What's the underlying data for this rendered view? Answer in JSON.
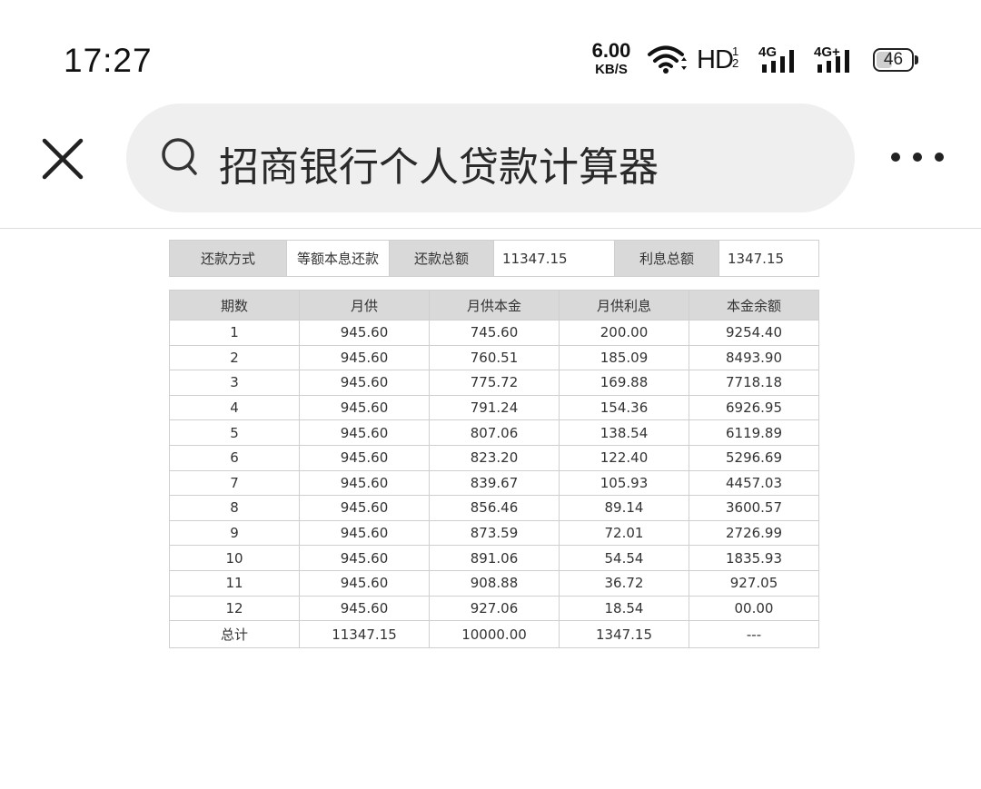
{
  "status_bar": {
    "time": "17:27",
    "net_speed_value": "6.00",
    "net_speed_unit": "KB/S",
    "hd_label": "HD",
    "hd_sub_top": "1",
    "hd_sub_bottom": "2",
    "signal1_label": "4G",
    "signal2_label": "4G+",
    "battery_percent": "46",
    "battery_level": 0.46
  },
  "top_bar": {
    "search_query": "招商银行个人贷款计算器",
    "icons": [
      "close-icon",
      "search-icon",
      "more-icon"
    ]
  },
  "summary": {
    "repay_method_label": "还款方式",
    "repay_method_value": "等额本息还款",
    "total_repay_label": "还款总额",
    "total_repay_value": "11347.15",
    "total_interest_label": "利息总额",
    "total_interest_value": "1347.15"
  },
  "schedule": {
    "headers": [
      "期数",
      "月供",
      "月供本金",
      "月供利息",
      "本金余额"
    ],
    "rows": [
      [
        "1",
        "945.60",
        "745.60",
        "200.00",
        "9254.40"
      ],
      [
        "2",
        "945.60",
        "760.51",
        "185.09",
        "8493.90"
      ],
      [
        "3",
        "945.60",
        "775.72",
        "169.88",
        "7718.18"
      ],
      [
        "4",
        "945.60",
        "791.24",
        "154.36",
        "6926.95"
      ],
      [
        "5",
        "945.60",
        "807.06",
        "138.54",
        "6119.89"
      ],
      [
        "6",
        "945.60",
        "823.20",
        "122.40",
        "5296.69"
      ],
      [
        "7",
        "945.60",
        "839.67",
        "105.93",
        "4457.03"
      ],
      [
        "8",
        "945.60",
        "856.46",
        "89.14",
        "3600.57"
      ],
      [
        "9",
        "945.60",
        "873.59",
        "72.01",
        "2726.99"
      ],
      [
        "10",
        "945.60",
        "891.06",
        "54.54",
        "1835.93"
      ],
      [
        "11",
        "945.60",
        "908.88",
        "36.72",
        "927.05"
      ],
      [
        "12",
        "945.60",
        "927.06",
        "18.54",
        "00.00"
      ]
    ],
    "total": [
      "总计",
      "11347.15",
      "10000.00",
      "1347.15",
      "---"
    ]
  }
}
